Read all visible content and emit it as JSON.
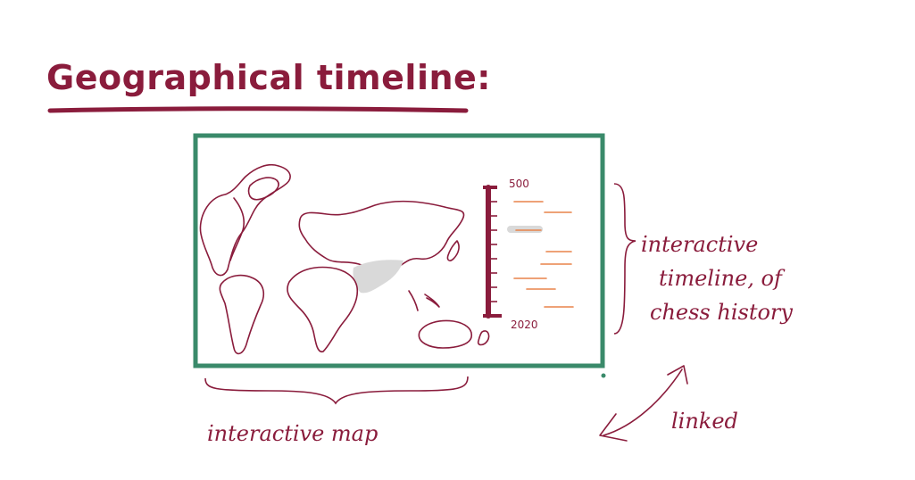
{
  "title": "Geographical timeline:",
  "timeline": {
    "top_label": "500",
    "bottom_label": "2020"
  },
  "annotations": {
    "timeline_note_line1": "interactive",
    "timeline_note_line2": "timeline, of",
    "timeline_note_line3": "chess history",
    "map_note": "interactive map",
    "link_note": "linked"
  },
  "colors": {
    "ink": "#8a1c3c",
    "frame": "#3a8a6a",
    "event_line": "#e8844a",
    "highlight": "#d9d9d9"
  }
}
